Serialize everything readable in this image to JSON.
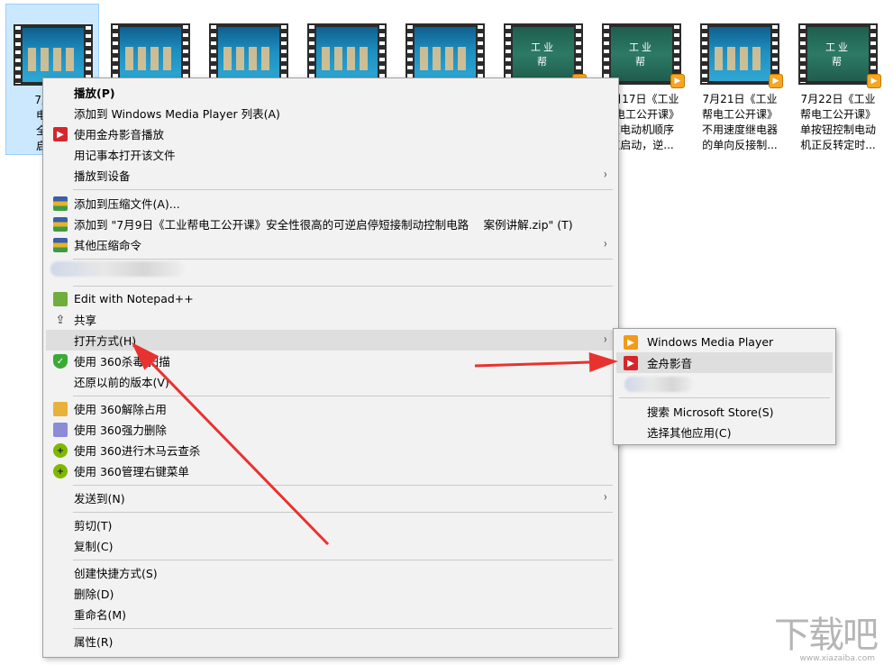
{
  "thumbnails": [
    {
      "caption": "7月9日\n电工公\n全性很\n启停短",
      "selected": true,
      "style": "light",
      "badge": false
    },
    {
      "caption": "",
      "selected": false,
      "style": "light",
      "badge": false
    },
    {
      "caption": "",
      "selected": false,
      "style": "light",
      "badge": false
    },
    {
      "caption": "",
      "selected": false,
      "style": "light",
      "badge": false
    },
    {
      "caption": "",
      "selected": false,
      "style": "light",
      "badge": false
    },
    {
      "caption": "",
      "selected": false,
      "style": "dark",
      "badge": true,
      "logo": "工业帮"
    },
    {
      "caption": "7月17日《工业\n帮电工公开课》\n速电动机顺序\n速启动，逆...",
      "selected": false,
      "style": "dark",
      "badge": true,
      "logo": "工业帮"
    },
    {
      "caption": "7月21日《工业\n帮电工公开课》\n不用速度继电器\n的单向反接制...",
      "selected": false,
      "style": "light",
      "badge": true
    },
    {
      "caption": "7月22日《工业\n帮电工公开课》\n单按钮控制电动\n机正反转定时...",
      "selected": false,
      "style": "dark",
      "badge": true,
      "logo": "工业帮"
    }
  ],
  "menu": {
    "play": "播放(P)",
    "add_wmp_list": "添加到 Windows Media Player 列表(A)",
    "play_jinzhou": "使用金舟影音播放",
    "open_notepad": "用记事本打开该文件",
    "cast_device": "播放到设备",
    "add_archive": "添加到压缩文件(A)...",
    "add_to_zip": "添加到 \"7月9日《工业帮电工公开课》安全性很高的可逆启停短接制动控制电路　 案例讲解.zip\" (T)",
    "other_compress": "其他压缩命令",
    "edit_notepadpp": "Edit with Notepad++",
    "share": "共享",
    "open_with": "打开方式(H)",
    "scan_360": "使用 360杀毒 扫描",
    "restore_prev": "还原以前的版本(V)",
    "unlock_360": "使用 360解除占用",
    "force_delete_360": "使用 360强力删除",
    "trojan_scan_360": "使用 360进行木马云查杀",
    "manage_menu_360": "使用 360管理右键菜单",
    "send_to": "发送到(N)",
    "cut": "剪切(T)",
    "copy": "复制(C)",
    "create_shortcut": "创建快捷方式(S)",
    "delete": "删除(D)",
    "rename": "重命名(M)",
    "properties": "属性(R)"
  },
  "submenu": {
    "wmp": "Windows Media Player",
    "jinzhou": "金舟影音",
    "search_store": "搜索 Microsoft Store(S)",
    "choose_other": "选择其他应用(C)"
  },
  "icons": {
    "arrow": "›",
    "player": "▶",
    "share": "⇪",
    "shield": "✓",
    "plus": "+"
  },
  "colors": {
    "annotation_arrow": "#e8322f",
    "menu_bg": "#f2f2f2",
    "selection": "#cce8ff"
  },
  "watermark": {
    "text": "下载吧",
    "url": "www.xiazaiba.com"
  }
}
